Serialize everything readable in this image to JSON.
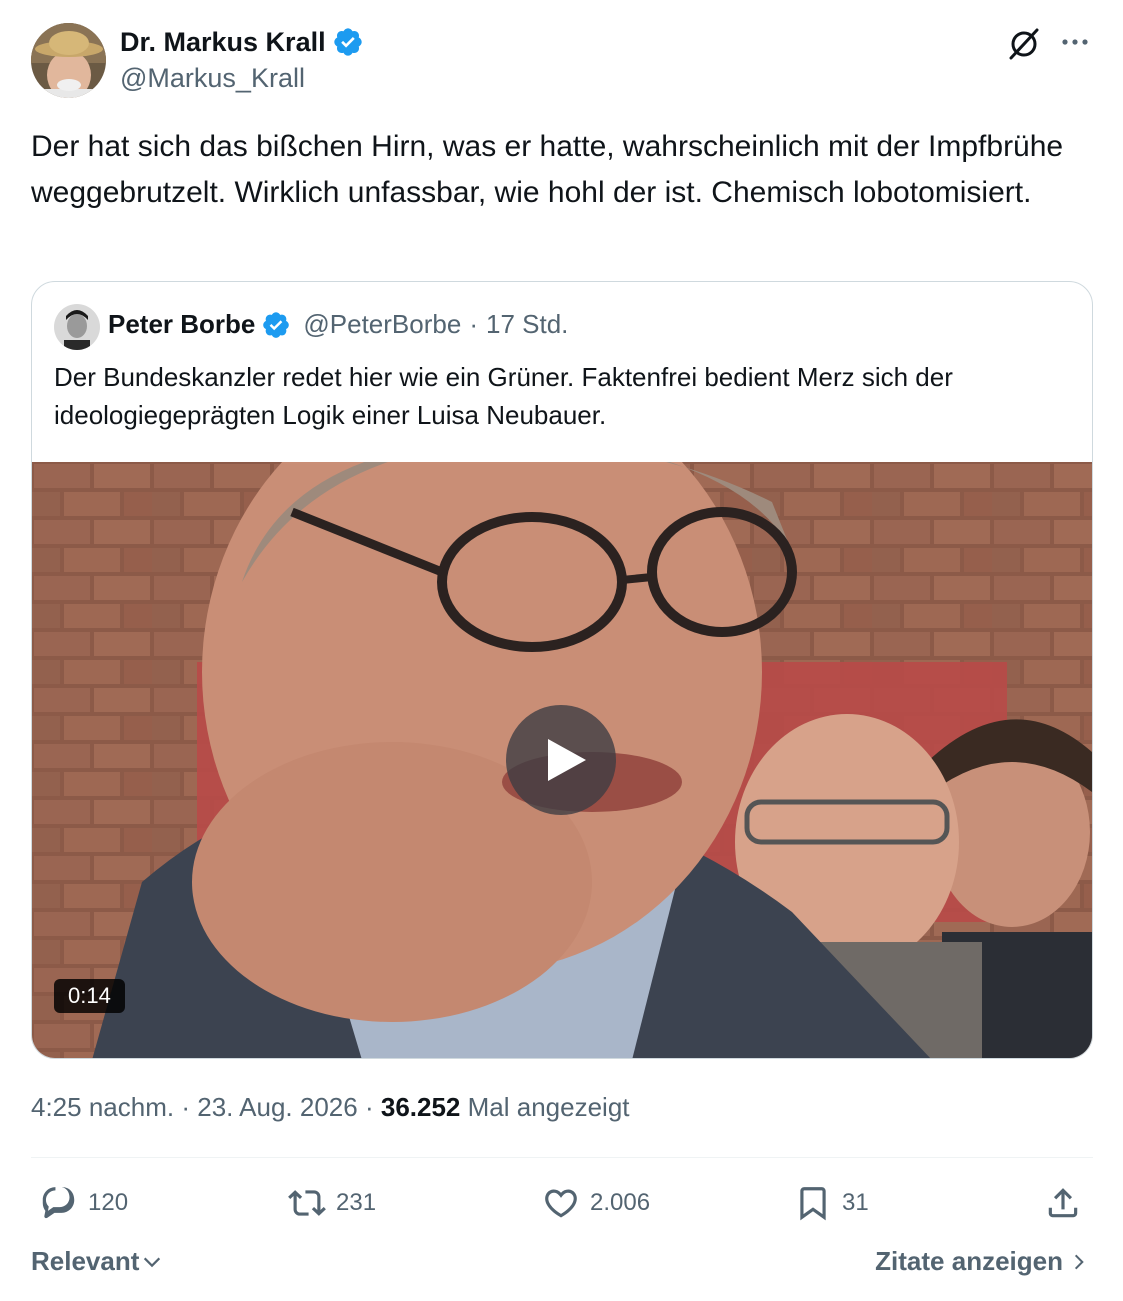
{
  "author": {
    "name": "Dr. Markus Krall",
    "handle": "@Markus_Krall"
  },
  "tweet": {
    "text": "Der hat sich das bißchen Hirn, was er hatte, wahrscheinlich mit der Impfbrühe weggebrutzelt. Wirklich unfassbar, wie hohl der ist. Chemisch lobotomisiert."
  },
  "quoted": {
    "name": "Peter Borbe",
    "handle": "@PeterBorbe",
    "separator": "·",
    "time": "17 Std.",
    "text": "Der Bundeskanzler redet hier wie ein Grüner. Faktenfrei bedient Merz sich der ideologiegeprägten Logik einer Luisa Neubauer.",
    "video_duration": "0:14"
  },
  "meta": {
    "time": "4:25 nachm.",
    "date": "23. Aug. 2026",
    "separator": "·",
    "views": "36.252",
    "views_label": "Mal angezeigt"
  },
  "actions": {
    "replies": "120",
    "reposts": "231",
    "likes": "2.006",
    "bookmarks": "31"
  },
  "footer": {
    "sort_label": "Relevant",
    "quotes_label": "Zitate anzeigen"
  },
  "colors": {
    "verified": "#1d9bf0",
    "text": "#0f1419",
    "secondary": "#536471",
    "border": "#cfd9de"
  }
}
